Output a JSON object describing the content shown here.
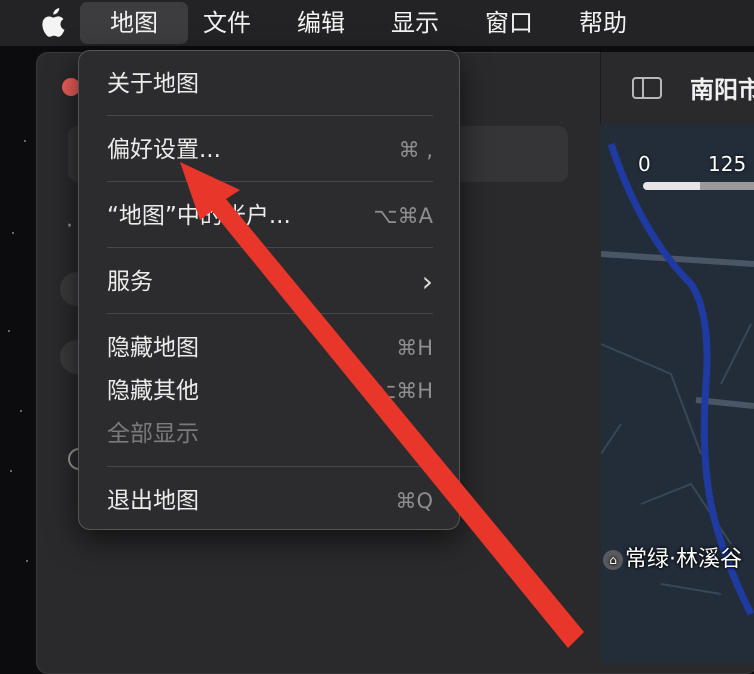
{
  "menubar": {
    "items": [
      "地图",
      "文件",
      "编辑",
      "显示",
      "窗口",
      "帮助"
    ],
    "active_index": 0
  },
  "dropdown": {
    "items": [
      {
        "label": "关于地图",
        "shortcut": ""
      },
      {
        "label": "偏好设置...",
        "shortcut": "⌘ ,"
      },
      {
        "label": "“地图”中的帐户...",
        "shortcut": "⌥⌘A"
      },
      {
        "label": "服务",
        "shortcut": "›"
      },
      {
        "label": "隐藏地图",
        "shortcut": "⌘H"
      },
      {
        "label": "隐藏其他",
        "shortcut": "⌥⌘H"
      },
      {
        "label": "全部显示",
        "shortcut": "",
        "disabled": true
      },
      {
        "label": "退出地图",
        "shortcut": "⌘Q"
      }
    ]
  },
  "map": {
    "title": "南阳市",
    "scale_start": "0",
    "scale_mid": "125",
    "place_label": "常绿·林溪谷"
  },
  "colors": {
    "menubar_bg": "#232325",
    "dropdown_bg": "#2c2c2e",
    "arrow": "#e8362a",
    "river": "#1e3a9e"
  },
  "icons": [
    "apple-icon",
    "sidebar-toggle-icon",
    "chevron-right-icon"
  ]
}
